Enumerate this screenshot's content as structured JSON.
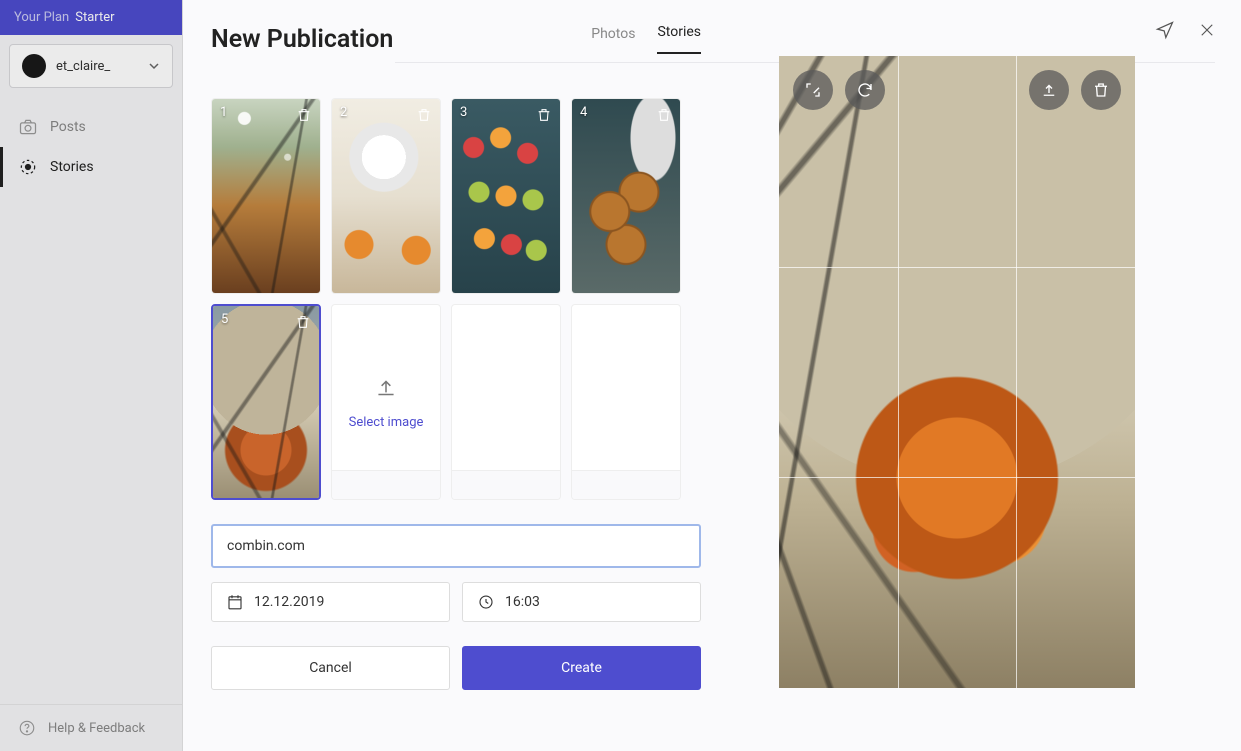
{
  "plan": {
    "label": "Your Plan",
    "name": "Starter"
  },
  "account": {
    "name": "et_claire_",
    "avatar_text": ""
  },
  "nav": {
    "posts": "Posts",
    "stories": "Stories"
  },
  "help": "Help & Feedback",
  "modal": {
    "title": "New Publication",
    "tabs": {
      "photos": "Photos",
      "stories": "Stories"
    },
    "thumbs": [
      {
        "num": "1"
      },
      {
        "num": "2"
      },
      {
        "num": "3"
      },
      {
        "num": "4"
      },
      {
        "num": "5"
      }
    ],
    "select_image": "Select image",
    "link_value": "combin.com",
    "date": "12.12.2019",
    "time": "16:03",
    "cancel": "Cancel",
    "create": "Create"
  },
  "colors": {
    "accent": "#4e4dcf"
  }
}
